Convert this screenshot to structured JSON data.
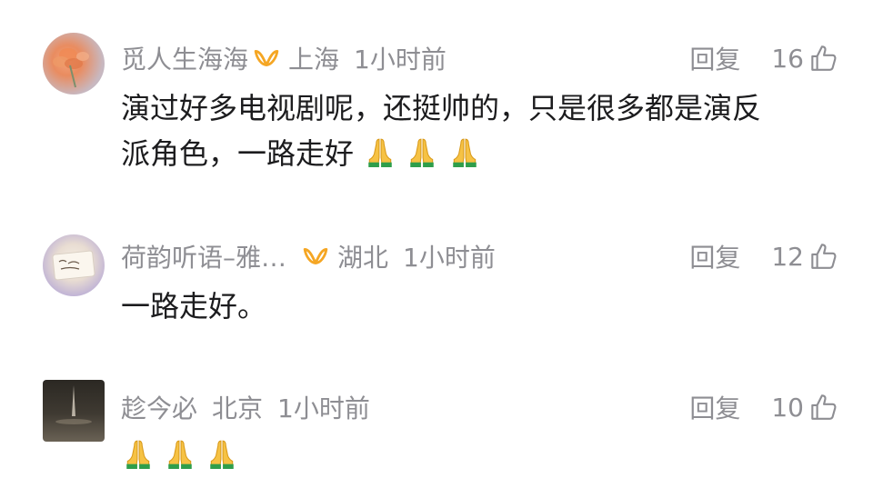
{
  "comments": [
    {
      "username": "觅人生海海",
      "location": "上海",
      "time": "1小时前",
      "reply_label": "回复",
      "likes": "16",
      "text_line1": "演过好多电视剧呢，还挺帅的，只是很多都是演反",
      "text_line2": "派角色，一路走好",
      "emoji_count": 3
    },
    {
      "username": "荷韵听语–雅…",
      "location": "湖北",
      "time": "1小时前",
      "reply_label": "回复",
      "likes": "12",
      "text_line1": "一路走好。",
      "emoji_count": 0
    },
    {
      "username": "趁今必",
      "location": "北京",
      "time": "1小时前",
      "reply_label": "回复",
      "likes": "10",
      "emoji_count": 3
    }
  ],
  "colors": {
    "meta_text": "#8e8e93",
    "content_text": "#1c1c1e",
    "vip_badge": "#f5a623"
  },
  "icons": {
    "vip": "vip-badge-icon",
    "like": "thumbs-up-icon",
    "pray": "folded-hands-emoji"
  }
}
